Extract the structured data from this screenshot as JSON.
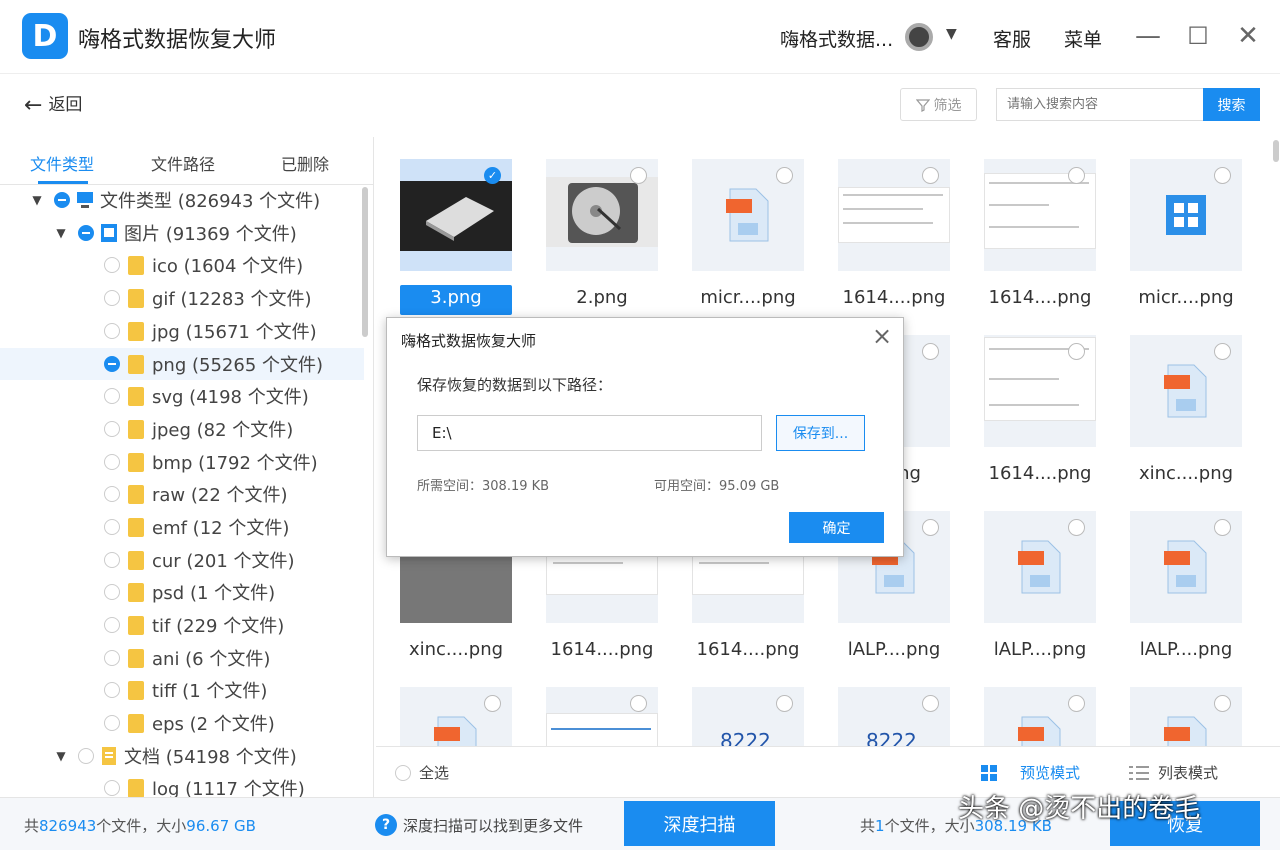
{
  "app": {
    "title": "嗨格式数据恢复大师",
    "account": "嗨格式数据...",
    "service": "客服",
    "menu": "菜单"
  },
  "toolbar": {
    "back": "返回",
    "filter": "筛选",
    "search_placeholder": "请输入搜索内容",
    "search_button": "搜索"
  },
  "sidebar": {
    "tabs": [
      "文件类型",
      "文件路径",
      "已删除"
    ],
    "tree": [
      {
        "label": "文件类型 (826943 个文件)"
      },
      {
        "label": "图片 (91369 个文件)"
      },
      {
        "label": "ico (1604 个文件)"
      },
      {
        "label": "gif (12283 个文件)"
      },
      {
        "label": "jpg (15671 个文件)"
      },
      {
        "label": "png (55265 个文件)"
      },
      {
        "label": "svg (4198 个文件)"
      },
      {
        "label": "jpeg (82 个文件)"
      },
      {
        "label": "bmp (1792 个文件)"
      },
      {
        "label": "raw (22 个文件)"
      },
      {
        "label": "emf (12 个文件)"
      },
      {
        "label": "cur (201 个文件)"
      },
      {
        "label": "psd (1 个文件)"
      },
      {
        "label": "tif (229 个文件)"
      },
      {
        "label": "ani (6 个文件)"
      },
      {
        "label": "tiff (1 个文件)"
      },
      {
        "label": "eps (2 个文件)"
      },
      {
        "label": "文档 (54198 个文件)"
      },
      {
        "label": "log (1117 个文件)"
      }
    ]
  },
  "files": [
    {
      "name": "3.png"
    },
    {
      "name": "2.png"
    },
    {
      "name": "micr....png"
    },
    {
      "name": "1614....png"
    },
    {
      "name": "1614....png"
    },
    {
      "name": "micr....png"
    },
    {
      "name": ".png"
    },
    {
      "name": "1614....png"
    },
    {
      "name": "xinc....png"
    },
    {
      "name": "xinc....png"
    },
    {
      "name": "1614....png"
    },
    {
      "name": "1614....png"
    },
    {
      "name": "lALP....png"
    },
    {
      "name": "lALP....png"
    },
    {
      "name": "lALP....png"
    }
  ],
  "thumb_texts": {
    "num": "22",
    "num2": "8222"
  },
  "footer": {
    "select_all": "全选",
    "preview_mode": "预览模式",
    "list_mode": "列表模式"
  },
  "status": {
    "total_prefix": "共",
    "total_count": "826943",
    "total_mid": "个文件，大小",
    "total_size": "96.67 GB",
    "tip": "深度扫描可以找到更多文件",
    "deep_scan": "深度扫描",
    "sel_prefix": "共",
    "sel_count": "1",
    "sel_mid": "个文件，大小",
    "sel_size": "308.19 KB",
    "recover": "恢复"
  },
  "watermark": "头条 @烫不出的卷毛",
  "dialog": {
    "title": "嗨格式数据恢复大师",
    "label": "保存恢复的数据到以下路径：",
    "path": "E:\\",
    "browse": "保存到...",
    "need_space": "所需空间：308.19 KB",
    "avail_space": "可用空间：95.09 GB",
    "ok": "确定"
  },
  "colors": {
    "accent": "#1a8cf0",
    "folder": "#f5c542",
    "doc_icon": "#f0652f"
  }
}
